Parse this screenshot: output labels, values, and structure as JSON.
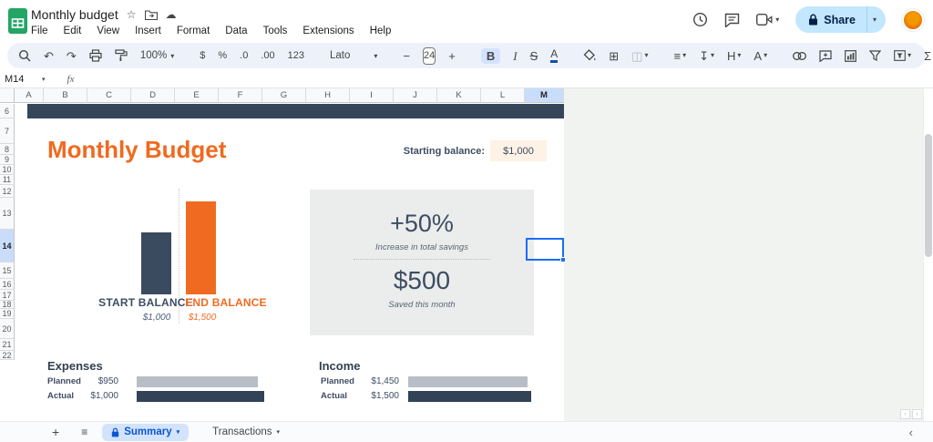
{
  "titlebar": {
    "doc_title": "Monthly budget",
    "menus": [
      "File",
      "Edit",
      "View",
      "Insert",
      "Format",
      "Data",
      "Tools",
      "Extensions",
      "Help"
    ],
    "share_label": "Share"
  },
  "icons": {
    "star": "☆",
    "cloud": "☁",
    "dropdown": "▾",
    "undo": "↶",
    "redo": "↷",
    "borders": "⊞",
    "merge": "◫",
    "align": "≡",
    "valign": "↧",
    "minus": "−",
    "plus": "+",
    "add_sheet": "+",
    "all_sheets": "≡",
    "collapse_left": "‹",
    "scroll_left": "‹",
    "scroll_right": "›"
  },
  "toolbar": {
    "zoom_value": "100%",
    "currency": "$",
    "percent": "%",
    "decimal_decrease": ".0",
    "decimal_increase": ".00",
    "plain_format": "123",
    "font_name": "Lato",
    "font_size": "24",
    "bold": "B",
    "italic": "I",
    "strikethrough": "S",
    "text_color": "A",
    "wrap": "H",
    "rotate": "A",
    "sum": "Σ"
  },
  "formula_bar": {
    "cell_ref": "M14",
    "fx_label": "fx"
  },
  "grid": {
    "columns": [
      "A",
      "B",
      "C",
      "D",
      "E",
      "F",
      "G",
      "H",
      "I",
      "J",
      "K",
      "L",
      "M"
    ],
    "rows": [
      "6",
      "7",
      "8",
      "9",
      "10",
      "11",
      "12",
      "13",
      "14",
      "15",
      "16",
      "17",
      "18",
      "19",
      "20",
      "21",
      "22"
    ],
    "selected_column": "M",
    "selected_row": "14"
  },
  "sheet": {
    "title": "Monthly Budget",
    "starting_balance_label": "Starting balance:",
    "starting_balance_value": "$1,000",
    "balance_chart": {
      "bars": [
        {
          "label": "START BALANCE",
          "value": "$1,000"
        },
        {
          "label": "END BALANCE",
          "value": "$1,500"
        }
      ]
    },
    "stats": {
      "percent": "+50%",
      "percent_caption": "Increase in total savings",
      "amount": "$500",
      "amount_caption": "Saved this month"
    },
    "expenses": {
      "heading": "Expenses",
      "rows": [
        {
          "label": "Planned",
          "value": "$950"
        },
        {
          "label": "Actual",
          "value": "$1,000"
        }
      ]
    },
    "income": {
      "heading": "Income",
      "rows": [
        {
          "label": "Planned",
          "value": "$1,450"
        },
        {
          "label": "Actual",
          "value": "$1,500"
        }
      ]
    }
  },
  "tabbar": {
    "tabs": [
      {
        "label": "Summary",
        "active": true,
        "locked": true
      },
      {
        "label": "Transactions",
        "active": false,
        "locked": false
      }
    ]
  },
  "colors": {
    "accent_orange": "#f06b21",
    "navy": "#3a4a5f",
    "gray_bar": "#b7bec7",
    "selection_blue": "#1b6ef3",
    "highlight_cell": "#fdf2e5"
  },
  "chart_data": [
    {
      "type": "bar",
      "title": "Balance",
      "categories": [
        "START BALANCE",
        "END BALANCE"
      ],
      "values": [
        1000,
        1500
      ],
      "colors": [
        "#3a4a5f",
        "#f06b21"
      ]
    },
    {
      "type": "bar",
      "title": "Expenses",
      "categories": [
        "Planned",
        "Actual"
      ],
      "values": [
        950,
        1000
      ],
      "colors": [
        "#b7bec7",
        "#324257"
      ]
    },
    {
      "type": "bar",
      "title": "Income",
      "categories": [
        "Planned",
        "Actual"
      ],
      "values": [
        1450,
        1500
      ],
      "colors": [
        "#b7bec7",
        "#324257"
      ]
    }
  ]
}
